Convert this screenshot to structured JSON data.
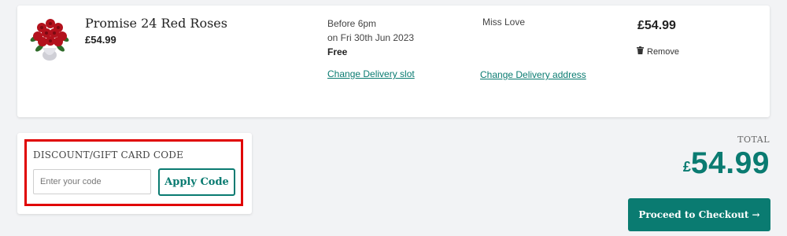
{
  "cart_item": {
    "image_alt": "Red roses bouquet",
    "name": "Promise 24 Red Roses",
    "price": "£54.99",
    "delivery_time": "Before 6pm",
    "delivery_date": "on Fri 30th Jun 2023",
    "delivery_cost": "Free",
    "change_slot_label": "Change Delivery slot",
    "recipient": "Miss Love",
    "change_address_label": "Change Delivery address",
    "line_total": "£54.99",
    "remove_label": "Remove",
    "remove_icon": "trash-icon"
  },
  "discount": {
    "title": "DISCOUNT/GIFT CARD CODE",
    "placeholder": "Enter your code",
    "value": "",
    "apply_label": "Apply Code",
    "highlight_color": "#e00000"
  },
  "summary": {
    "total_label": "TOTAL",
    "currency": "£",
    "total_value": "54.99",
    "checkout_label": "Proceed to Checkout →"
  },
  "colors": {
    "accent": "#0a7b71",
    "background": "#f2f3f5"
  }
}
